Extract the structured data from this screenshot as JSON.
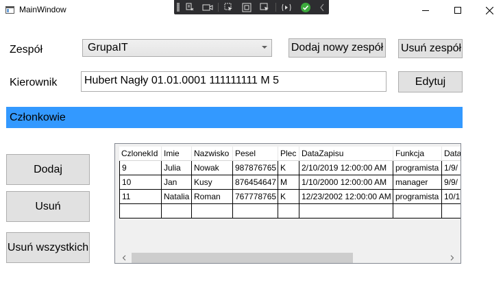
{
  "window": {
    "title": "MainWindow"
  },
  "team": {
    "label": "Zespół",
    "selected": "GrupaIT",
    "add_button": "Dodaj nowy zespół",
    "remove_button": "Usuń zespół"
  },
  "manager": {
    "label": "Kierownik",
    "value": "Hubert Nagły 01.01.0001 111111111 M 5",
    "edit_button": "Edytuj"
  },
  "members": {
    "header": "Członkowie",
    "add_button": "Dodaj",
    "remove_button": "Usuń",
    "remove_all_button": "Usuń wszystkich"
  },
  "grid": {
    "columns": [
      "CzlonekId",
      "Imie",
      "Nazwisko",
      "Pesel",
      "Plec",
      "DataZapisu",
      "Funkcja",
      "Data"
    ],
    "rows": [
      [
        "9",
        "Julia",
        "Nowak",
        "987876765",
        "K",
        "2/10/2019 12:00:00 AM",
        "programista",
        "1/9/"
      ],
      [
        "10",
        "Jan",
        "Kusy",
        "876454647",
        "M",
        "1/10/2000 12:00:00 AM",
        "manager",
        "9/9/"
      ],
      [
        "11",
        "Natalia",
        "Roman",
        "767778765",
        "K",
        "12/23/2002 12:00:00 AM",
        "programista",
        "10/1"
      ],
      [
        "",
        "",
        "",
        "",
        "",
        "",
        "",
        ""
      ]
    ]
  },
  "colors": {
    "header_accent": "#3399ff",
    "debug_toolbar": "#2d2d30"
  }
}
